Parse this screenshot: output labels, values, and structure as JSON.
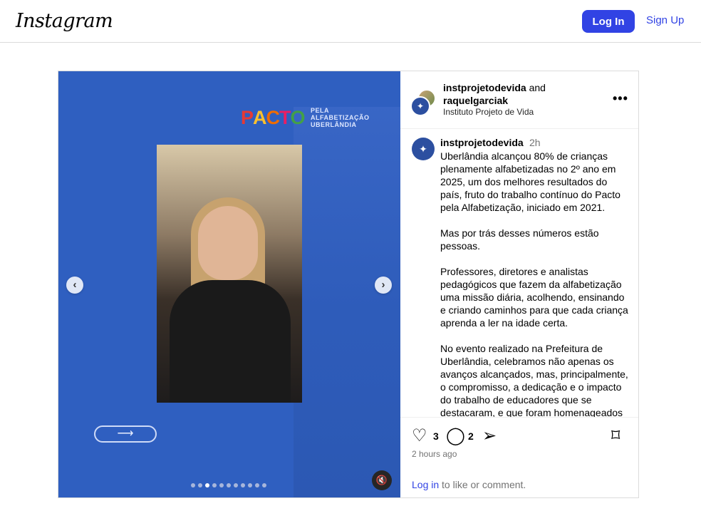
{
  "header": {
    "logo": "Instagram",
    "login_label": "Log In",
    "signup_label": "Sign Up"
  },
  "media": {
    "brand_title": "PACTO",
    "brand_line1": "PELA",
    "brand_line2": "ALFABETIZAÇÃO",
    "brand_line3": "UBERLÂNDIA",
    "prev_icon": "chevron-left-icon",
    "next_icon": "chevron-right-icon",
    "mute_icon": "muted-speaker-icon",
    "slide_count": 11,
    "active_slide": 3
  },
  "post_header": {
    "user1": "instprojetodevida",
    "and_text": "and",
    "user2": "raquelgarciak",
    "subtitle": "Instituto Projeto de Vida",
    "more_icon": "more-options-icon"
  },
  "caption": {
    "username": "instprojetodevida",
    "time": "2h",
    "paragraphs": [
      "Uberlândia alcançou 80% de crianças plenamente alfabetizadas no 2º ano em 2025, um dos melhores resultados do país, fruto do trabalho contínuo do Pacto pela Alfabetização, iniciado em 2021.",
      "Mas por trás desses números estão pessoas.",
      "Professores, diretores e analistas pedagógicos que fazem da alfabetização uma missão diária, acolhendo, ensinando e criando caminhos para que cada criança aprenda a ler na idade certa.",
      "No evento realizado na Prefeitura de Uberlândia, celebramos não apenas os avanços alcançados, mas, principalmente, o compromisso, a dedicação e o impacto do trabalho de educadores que se destacaram, e que foram homenageados"
    ]
  },
  "actions": {
    "like_count": "3",
    "comment_count": "2",
    "time_ago": "2 hours ago",
    "login_link": "Log in",
    "login_suffix": " to like or comment."
  }
}
